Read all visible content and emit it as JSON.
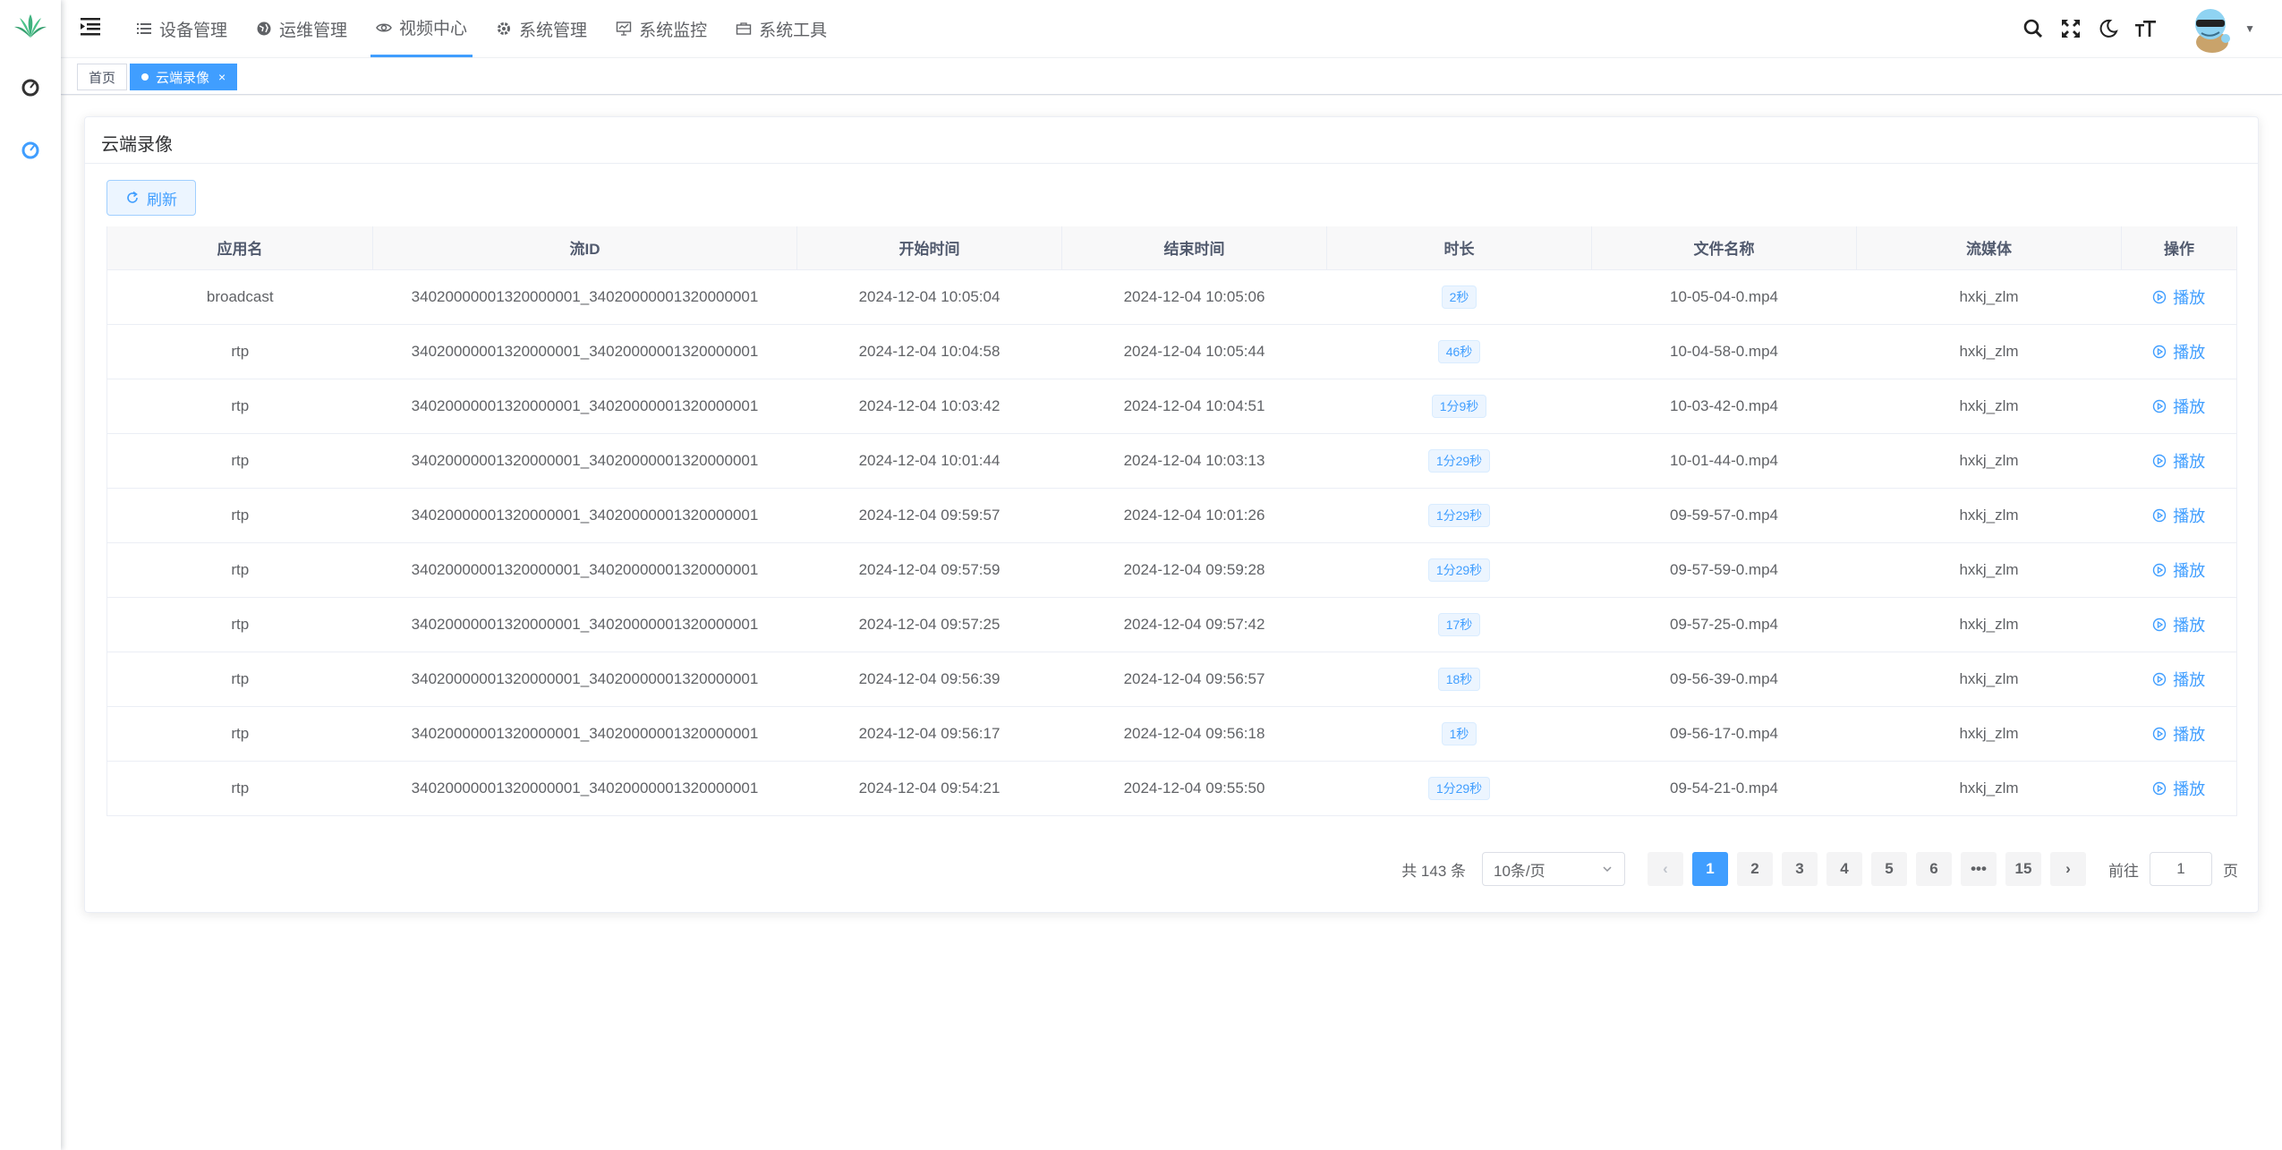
{
  "nav": {
    "menu": [
      {
        "label": "设备管理",
        "icon": "list-icon"
      },
      {
        "label": "运维管理",
        "icon": "globe-icon"
      },
      {
        "label": "视频中心",
        "icon": "eye-icon"
      },
      {
        "label": "系统管理",
        "icon": "gear-icon"
      },
      {
        "label": "系统监控",
        "icon": "monitor-icon"
      },
      {
        "label": "系统工具",
        "icon": "toolbox-icon"
      }
    ],
    "active_index": 2
  },
  "tags": {
    "home": "首页",
    "current": "云端录像",
    "close": "×"
  },
  "card": {
    "title": "云端录像",
    "refresh_label": "刷新"
  },
  "table": {
    "headers": [
      "应用名",
      "流ID",
      "开始时间",
      "结束时间",
      "时长",
      "文件名称",
      "流媒体",
      "操作"
    ],
    "action_label": "播放",
    "rows": [
      {
        "app": "broadcast",
        "stream": "34020000001320000001_34020000001320000001",
        "start": "2024-12-04 10:05:04",
        "end": "2024-12-04 10:05:06",
        "duration": "2秒",
        "file": "10-05-04-0.mp4",
        "media": "hxkj_zlm"
      },
      {
        "app": "rtp",
        "stream": "34020000001320000001_34020000001320000001",
        "start": "2024-12-04 10:04:58",
        "end": "2024-12-04 10:05:44",
        "duration": "46秒",
        "file": "10-04-58-0.mp4",
        "media": "hxkj_zlm"
      },
      {
        "app": "rtp",
        "stream": "34020000001320000001_34020000001320000001",
        "start": "2024-12-04 10:03:42",
        "end": "2024-12-04 10:04:51",
        "duration": "1分9秒",
        "file": "10-03-42-0.mp4",
        "media": "hxkj_zlm"
      },
      {
        "app": "rtp",
        "stream": "34020000001320000001_34020000001320000001",
        "start": "2024-12-04 10:01:44",
        "end": "2024-12-04 10:03:13",
        "duration": "1分29秒",
        "file": "10-01-44-0.mp4",
        "media": "hxkj_zlm"
      },
      {
        "app": "rtp",
        "stream": "34020000001320000001_34020000001320000001",
        "start": "2024-12-04 09:59:57",
        "end": "2024-12-04 10:01:26",
        "duration": "1分29秒",
        "file": "09-59-57-0.mp4",
        "media": "hxkj_zlm"
      },
      {
        "app": "rtp",
        "stream": "34020000001320000001_34020000001320000001",
        "start": "2024-12-04 09:57:59",
        "end": "2024-12-04 09:59:28",
        "duration": "1分29秒",
        "file": "09-57-59-0.mp4",
        "media": "hxkj_zlm"
      },
      {
        "app": "rtp",
        "stream": "34020000001320000001_34020000001320000001",
        "start": "2024-12-04 09:57:25",
        "end": "2024-12-04 09:57:42",
        "duration": "17秒",
        "file": "09-57-25-0.mp4",
        "media": "hxkj_zlm"
      },
      {
        "app": "rtp",
        "stream": "34020000001320000001_34020000001320000001",
        "start": "2024-12-04 09:56:39",
        "end": "2024-12-04 09:56:57",
        "duration": "18秒",
        "file": "09-56-39-0.mp4",
        "media": "hxkj_zlm"
      },
      {
        "app": "rtp",
        "stream": "34020000001320000001_34020000001320000001",
        "start": "2024-12-04 09:56:17",
        "end": "2024-12-04 09:56:18",
        "duration": "1秒",
        "file": "09-56-17-0.mp4",
        "media": "hxkj_zlm"
      },
      {
        "app": "rtp",
        "stream": "34020000001320000001_34020000001320000001",
        "start": "2024-12-04 09:54:21",
        "end": "2024-12-04 09:55:50",
        "duration": "1分29秒",
        "file": "09-54-21-0.mp4",
        "media": "hxkj_zlm"
      }
    ]
  },
  "pager": {
    "total": "共 143 条",
    "page_size": "10条/页",
    "pages": [
      "1",
      "2",
      "3",
      "4",
      "5",
      "6",
      "•••",
      "15"
    ],
    "current": "1",
    "prev": "‹",
    "next": "›",
    "goto_prefix": "前往",
    "goto_value": "1",
    "goto_suffix": "页"
  },
  "colors": {
    "primary": "#409eff",
    "tag_bg": "#ecf5ff"
  }
}
